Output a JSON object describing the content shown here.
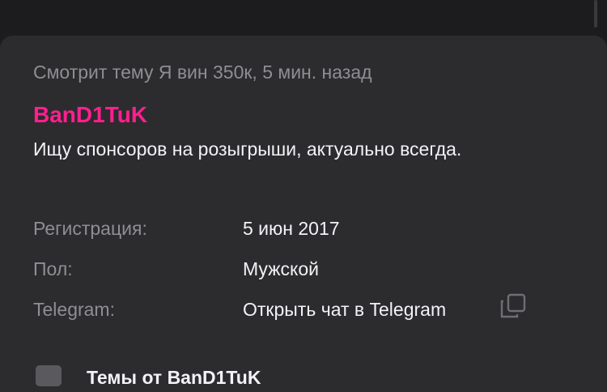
{
  "profile": {
    "activity": "Смотрит тему Я вин 350к, 5 мин. назад",
    "username": "BanD1TuK",
    "username_color": "#ff1f8e",
    "status": "Ищу спонсоров на розыгрыши, актуально всегда."
  },
  "details": {
    "registration_label": "Регистрация:",
    "registration_value": "5 июн 2017",
    "gender_label": "Пол:",
    "gender_value": "Мужской",
    "telegram_label": "Telegram:",
    "telegram_value": "Открыть чат в Telegram",
    "copy_icon": "copy-icon"
  },
  "topics": {
    "icon": "topics-icon",
    "label": "Темы от BanD1TuK"
  }
}
